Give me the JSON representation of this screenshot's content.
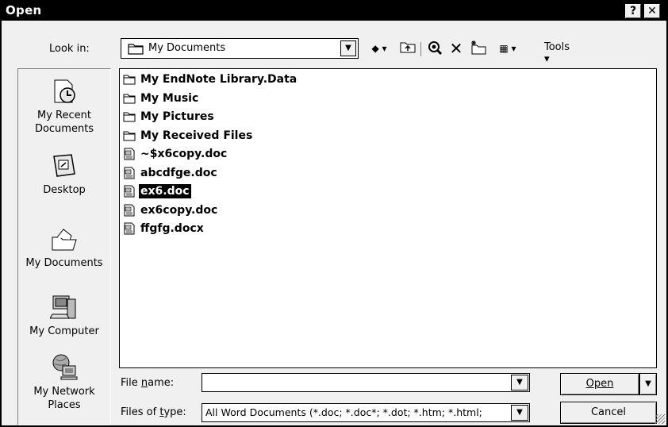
{
  "dialog": {
    "title": "Open",
    "help_glyph": "?",
    "close_glyph": "✕"
  },
  "lookin": {
    "label": "Look in:",
    "value": "My Documents",
    "tools_label": "Tools ▾"
  },
  "toolbar_icons": [
    "back-icon",
    "up-folder-icon",
    "search-web-icon",
    "delete-icon",
    "new-folder-icon",
    "views-icon",
    "tools-icon"
  ],
  "places": [
    {
      "label": "My Recent Documents",
      "icon": "recent-documents-icon"
    },
    {
      "label": "Desktop",
      "icon": "desktop-icon"
    },
    {
      "label": "My Documents",
      "icon": "my-documents-icon"
    },
    {
      "label": "My Computer",
      "icon": "my-computer-icon"
    },
    {
      "label": "My Network Places",
      "icon": "network-places-icon"
    }
  ],
  "files": [
    {
      "name": "My EndNote Library.Data",
      "type": "folder"
    },
    {
      "name": "My Music",
      "type": "folder"
    },
    {
      "name": "My Pictures",
      "type": "folder"
    },
    {
      "name": "My Received Files",
      "type": "folder"
    },
    {
      "name": "~$x6copy.doc",
      "type": "doc"
    },
    {
      "name": "abcdfge.doc",
      "type": "doc"
    },
    {
      "name": "ex6.doc",
      "type": "doc",
      "selected": true
    },
    {
      "name": "ex6copy.doc",
      "type": "doc"
    },
    {
      "name": "ffgfg.docx",
      "type": "doc"
    }
  ],
  "filename": {
    "label": "File name:",
    "value": ""
  },
  "filetype": {
    "label": "Files of type:",
    "value": "All Word Documents (*.doc; *.doc*; *.dot; *.htm; *.html;"
  },
  "buttons": {
    "open": "Open",
    "cancel": "Cancel"
  }
}
